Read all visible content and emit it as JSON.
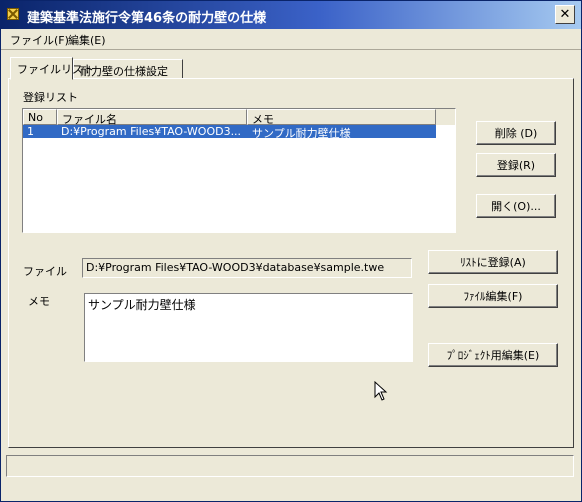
{
  "window": {
    "title": "建築基準法施行令第46条の耐力壁の仕様",
    "close_glyph": "✕"
  },
  "menu": [
    {
      "label": "ファイル(F)"
    },
    {
      "label": "編集(E)"
    }
  ],
  "tabs": [
    {
      "label": "ファイルリスト",
      "active": true
    },
    {
      "label": "耐力壁の仕様設定",
      "active": false
    }
  ],
  "list": {
    "group_label": "登録リスト",
    "columns": [
      "No",
      "ファイル名",
      "メモ"
    ],
    "rows": [
      {
        "no": "1",
        "filename": "D:¥Program Files¥TAO-WOOD3...",
        "memo": "サンプル耐力壁仕様",
        "selected": true
      }
    ]
  },
  "buttons": {
    "delete": "削除 (D)",
    "register": "登録(R)",
    "open": "開く(O)...",
    "add_to_list": "ﾘｽﾄに登録(A)",
    "edit_file": "ﾌｧｲﾙ編集(F)",
    "project_edit": "ﾌﾟﾛｼﾞｪｸﾄ用編集(E)"
  },
  "fields": {
    "file_label": "ファイル",
    "file_value": "D:¥Program Files¥TAO-WOOD3¥database¥sample.twe",
    "memo_label": "メモ",
    "memo_value": "サンプル耐力壁仕様"
  },
  "colors": {
    "selection": "#316ac5",
    "face": "#ece9d8",
    "title_start": "#0a246a"
  }
}
